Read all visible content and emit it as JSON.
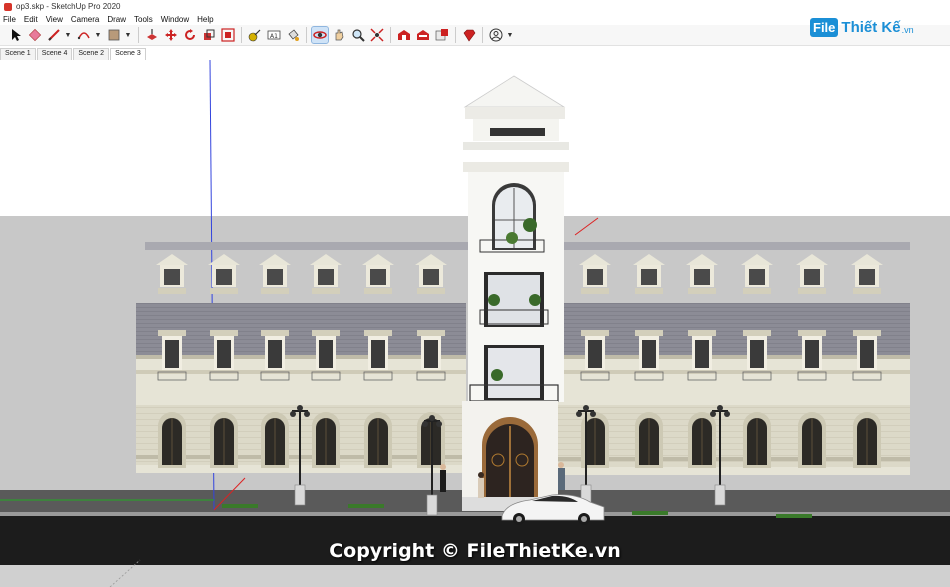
{
  "window": {
    "title": "op3.skp - SketchUp Pro 2020"
  },
  "menu": {
    "items": [
      "File",
      "Edit",
      "View",
      "Camera",
      "Draw",
      "Tools",
      "Window",
      "Help"
    ]
  },
  "toolbar": {
    "tools": [
      "select-icon",
      "eraser-icon",
      "pencil-icon",
      "arc-icon",
      "rectangle-icon",
      "push-pull-icon",
      "move-icon",
      "rotate-icon",
      "scale-icon",
      "offset-icon",
      "tape-measure-icon",
      "text-icon",
      "paint-bucket-icon",
      "orbit-icon",
      "pan-icon",
      "zoom-icon",
      "zoom-extents-icon",
      "warehouse-icon",
      "extension-icon",
      "layout-icon",
      "ruby-icon",
      "account-icon"
    ],
    "active_tool": "orbit-icon"
  },
  "watermark_logo": {
    "badge": "File",
    "text": "Thiết Kế",
    "suffix": ".vn",
    "color": "#1b8fd6"
  },
  "scene_tabs": [
    {
      "label": "Scene 1",
      "active": false
    },
    {
      "label": "Scene 4",
      "active": false
    },
    {
      "label": "Scene 2",
      "active": false
    },
    {
      "label": "Scene 3",
      "active": true
    }
  ],
  "copyright": "Copyright © FileThietKe.vn",
  "colors": {
    "sky": "#ffffff",
    "ground": "#c8c8c8",
    "road": "#1a1a1a",
    "facade": "#e6e4d6",
    "roof": "#8c8c96",
    "tower": "#f7f7f4",
    "door": "#8a5628",
    "axis_blue": "#3344dd",
    "axis_red": "#dd2222",
    "axis_green": "#22aa22"
  }
}
